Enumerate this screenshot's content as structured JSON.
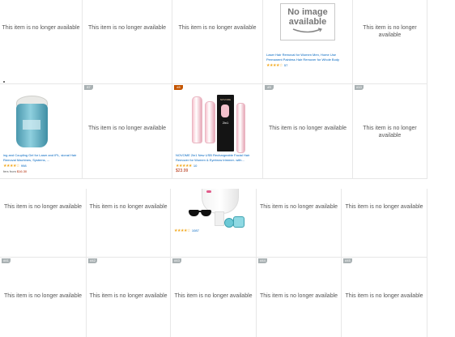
{
  "unavailable_text": "This item is no longer available",
  "no_image": {
    "line1": "No image",
    "line2": "available"
  },
  "row1": {
    "laser_product": {
      "title": "Laser Hair Removal for Women Men, Home Use Permanent Painless Hair Remover for Whole Body",
      "stars": "★★★★☆",
      "review_count": "57"
    }
  },
  "row2": {
    "gel_product": {
      "title": "ing and Coupling Gel for Laser and IPL, sional Hair Removal Machines, Systems, ...",
      "stars": "★★★★☆",
      "review_count": "998",
      "offer_label": "fers from",
      "offer_price": "$16.30"
    },
    "badges": [
      "87",
      "#8",
      "#9",
      "#10"
    ],
    "novome_product": {
      "title": "NOVOME 2in1 New USB Rechargeable Facial Hair Remover for Women & Eyebrow trimmer- with...",
      "stars": "★★★★★",
      "review_count": "10",
      "price": "$23.99",
      "box_brand": "NOVOME",
      "box_text": "2in1"
    }
  },
  "row3": {
    "ipl_product": {
      "stars": "★★★★☆",
      "review_count": "1087"
    }
  },
  "row4": {
    "badges": [
      "#41",
      "#42",
      "#43",
      "#44",
      "#45"
    ]
  },
  "colors": {
    "link": "#0066c0",
    "star": "#f2a91e",
    "price": "#b12704",
    "badge_orange": "#c45500",
    "badge_gray": "#a9b1b3"
  }
}
